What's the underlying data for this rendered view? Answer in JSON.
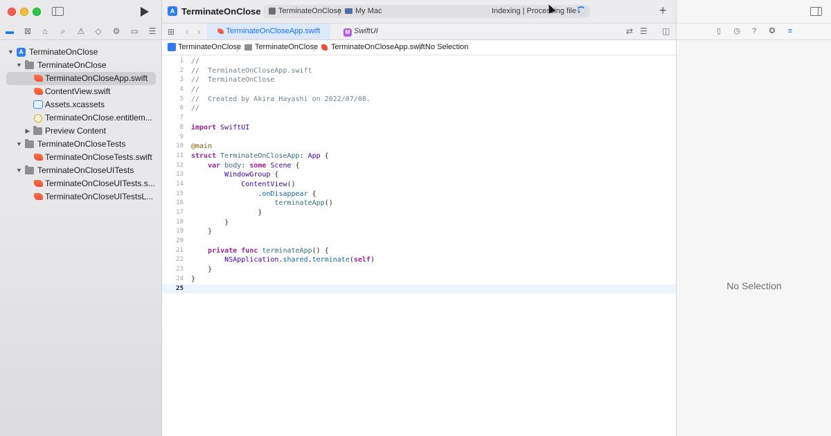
{
  "window": {
    "title": "TerminateOnClose"
  },
  "toolbar": {
    "scheme": "TerminateOnClose",
    "destination": "My Mac",
    "status": "Indexing | Processing files"
  },
  "navigator": {
    "tree": [
      {
        "label": "TerminateOnClose",
        "kind": "project",
        "level": 0,
        "expanded": true
      },
      {
        "label": "TerminateOnClose",
        "kind": "folder",
        "level": 1,
        "expanded": true
      },
      {
        "label": "TerminateOnCloseApp.swift",
        "kind": "swift",
        "level": 2,
        "selected": true
      },
      {
        "label": "ContentView.swift",
        "kind": "swift",
        "level": 2
      },
      {
        "label": "Assets.xcassets",
        "kind": "assets",
        "level": 2
      },
      {
        "label": "TerminateOnClose.entitlem...",
        "kind": "entitlements",
        "level": 2
      },
      {
        "label": "Preview Content",
        "kind": "folder",
        "level": 2,
        "expanded": false
      },
      {
        "label": "TerminateOnCloseTests",
        "kind": "folder",
        "level": 1,
        "expanded": true
      },
      {
        "label": "TerminateOnCloseTests.swift",
        "kind": "swift",
        "level": 2
      },
      {
        "label": "TerminateOnCloseUITests",
        "kind": "folder",
        "level": 1,
        "expanded": true
      },
      {
        "label": "TerminateOnCloseUITests.s...",
        "kind": "swift",
        "level": 2
      },
      {
        "label": "TerminateOnCloseUITestsL...",
        "kind": "swift",
        "level": 2
      }
    ]
  },
  "editor": {
    "tabs": [
      {
        "label": "TerminateOnCloseApp.swift",
        "active": true
      },
      {
        "label": "SwiftUI",
        "active": false
      }
    ],
    "breadcrumb": [
      "TerminateOnClose",
      "TerminateOnClose",
      "TerminateOnCloseApp.swift",
      "No Selection"
    ],
    "current_line": 25,
    "lines": [
      "//",
      "//  TerminateOnCloseApp.swift",
      "//  TerminateOnClose",
      "//",
      "//  Created by Akira Hayashi on 2022/07/08.",
      "//",
      "",
      "import SwiftUI",
      "",
      "@main",
      "struct TerminateOnCloseApp: App {",
      "    var body: some Scene {",
      "        WindowGroup {",
      "            ContentView()",
      "                .onDisappear {",
      "                    terminateApp()",
      "                }",
      "        }",
      "    }",
      "",
      "    private func terminateApp() {",
      "        NSApplication.shared.terminate(self)",
      "    }",
      "}",
      ""
    ]
  },
  "inspector": {
    "empty_label": "No Selection"
  },
  "colors": {
    "accent": "#1478f5",
    "selection": "#d0d0d4",
    "current_line": "#ecf5ff"
  }
}
